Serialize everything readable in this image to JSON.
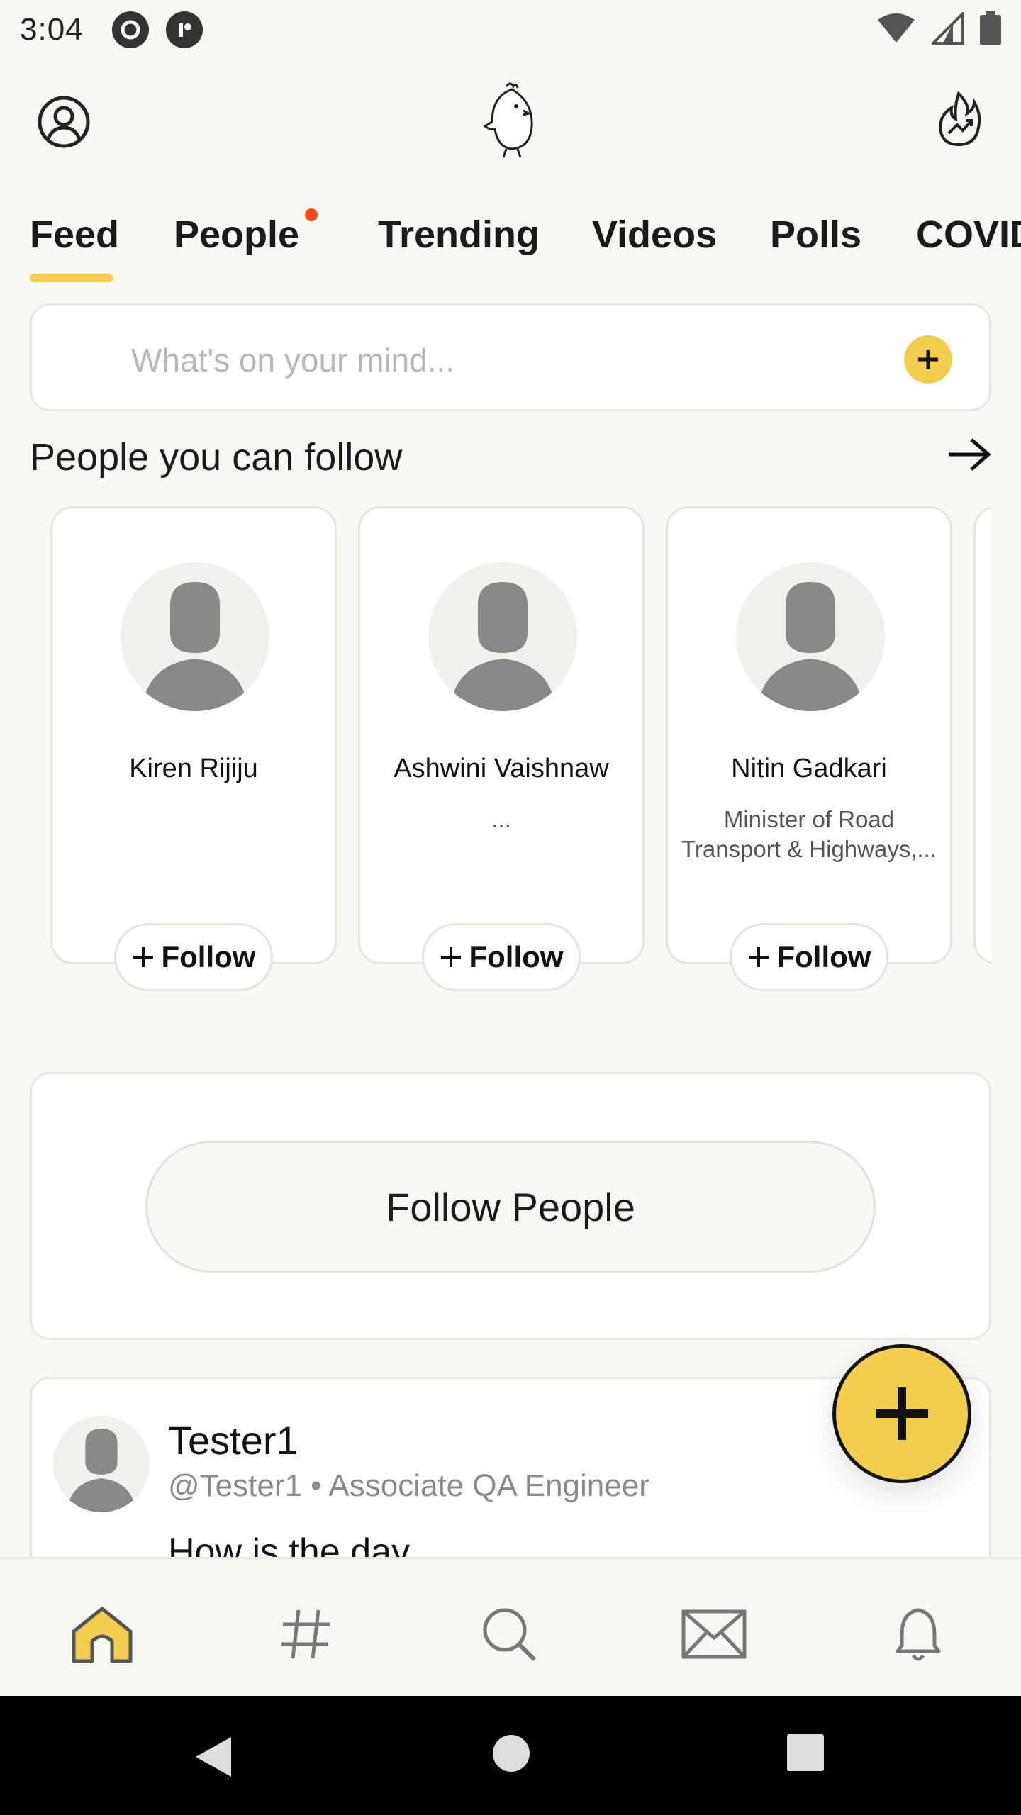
{
  "status_bar": {
    "time": "3:04"
  },
  "tabs": [
    {
      "label": "Feed",
      "active": true
    },
    {
      "label": "People",
      "has_dot": true
    },
    {
      "label": "Trending"
    },
    {
      "label": "Videos"
    },
    {
      "label": "Polls"
    },
    {
      "label": "COVID"
    }
  ],
  "composer": {
    "placeholder": "What's on your mind..."
  },
  "suggestions": {
    "title": "People you can follow",
    "people": [
      {
        "name": "Kiren Rijiju",
        "desc": "",
        "follow_label": "Follow"
      },
      {
        "name": "Ashwini Vaishnaw",
        "desc": "...",
        "follow_label": "Follow"
      },
      {
        "name": "Nitin Gadkari",
        "desc": "Minister of Road Transport & Highways,...",
        "follow_label": "Follow"
      }
    ]
  },
  "follow_people": {
    "label": "Follow People"
  },
  "post": {
    "name": "Tester1",
    "meta": "@Tester1 • Associate QA Engineer",
    "text": "How is the day"
  },
  "colors": {
    "accent": "#f2cd4f",
    "dot": "#ff4a13",
    "background": "#f8f7f4"
  },
  "bottom_nav": [
    "home-icon",
    "hashtag-icon",
    "search-icon",
    "mail-icon",
    "bell-icon"
  ]
}
